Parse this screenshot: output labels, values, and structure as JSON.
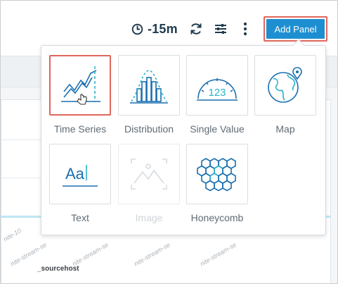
{
  "toolbar": {
    "time_range": "-15m",
    "add_panel_label": "Add Panel"
  },
  "dashboard": {
    "axis_labels": [
      "nite-10",
      "nite-stream-se",
      "nite-stream-se",
      "nite-stream-se",
      "nite-stream-se"
    ],
    "source_label": "_sourcehost"
  },
  "panel_menu": {
    "items": [
      {
        "label": "Time Series",
        "icon": "time-series-icon",
        "state": "hovered"
      },
      {
        "label": "Distribution",
        "icon": "distribution-icon",
        "state": "normal"
      },
      {
        "label": "Single Value",
        "icon": "single-value-icon",
        "state": "normal"
      },
      {
        "label": "Map",
        "icon": "map-icon",
        "state": "normal"
      },
      {
        "label": "Text",
        "icon": "text-icon",
        "state": "normal"
      },
      {
        "label": "Image",
        "icon": "image-icon",
        "state": "disabled"
      },
      {
        "label": "Honeycomb",
        "icon": "honeycomb-icon",
        "state": "normal"
      }
    ],
    "text_icon_glyph": "Aa",
    "single_value_glyph": "123"
  },
  "colors": {
    "accent": "#1d8fd1",
    "icon_blue": "#1a6fb0",
    "icon_teal": "#2bb3c9",
    "highlight": "#e0665b"
  }
}
